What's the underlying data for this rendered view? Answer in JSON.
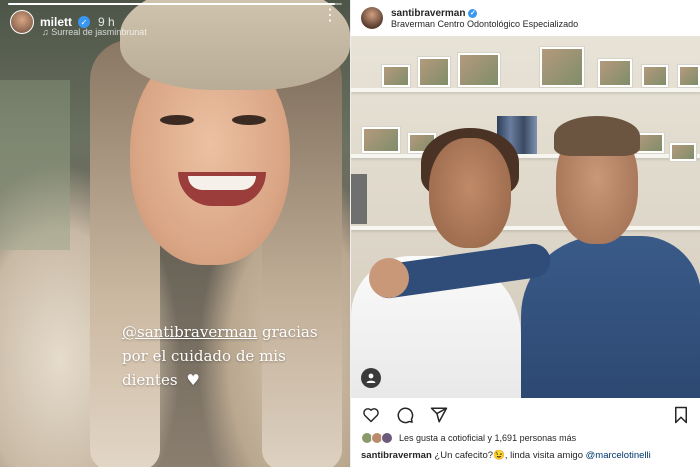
{
  "story": {
    "username": "milett",
    "time": "9 h",
    "music": "Surreal de jasminbrunat",
    "progress": 0.98,
    "caption": {
      "mention": "@santibraverman",
      "line1_rest": " gracias",
      "line2": "por el cuidado de mis",
      "line3": "dientes"
    },
    "icons": {
      "verified": "verified-icon",
      "more": "more-icon",
      "heart": "heart-icon"
    }
  },
  "post": {
    "username": "santibraverman",
    "subtitle": "Braverman Centro Odontológico Especializado",
    "likes_text": "Les gusta a cotioficial y 1,691 personas más",
    "caption_user": "santibraverman",
    "caption_text": " ¿Un cafecito?😉, linda visita amigo ",
    "caption_tag": "@marcelotinelli",
    "icons": {
      "verified": "verified-icon",
      "like": "heart-icon",
      "comment": "comment-icon",
      "share": "send-icon",
      "save": "bookmark-icon",
      "tagged_user": "user-tag-icon"
    },
    "accent": "#3897f0"
  }
}
